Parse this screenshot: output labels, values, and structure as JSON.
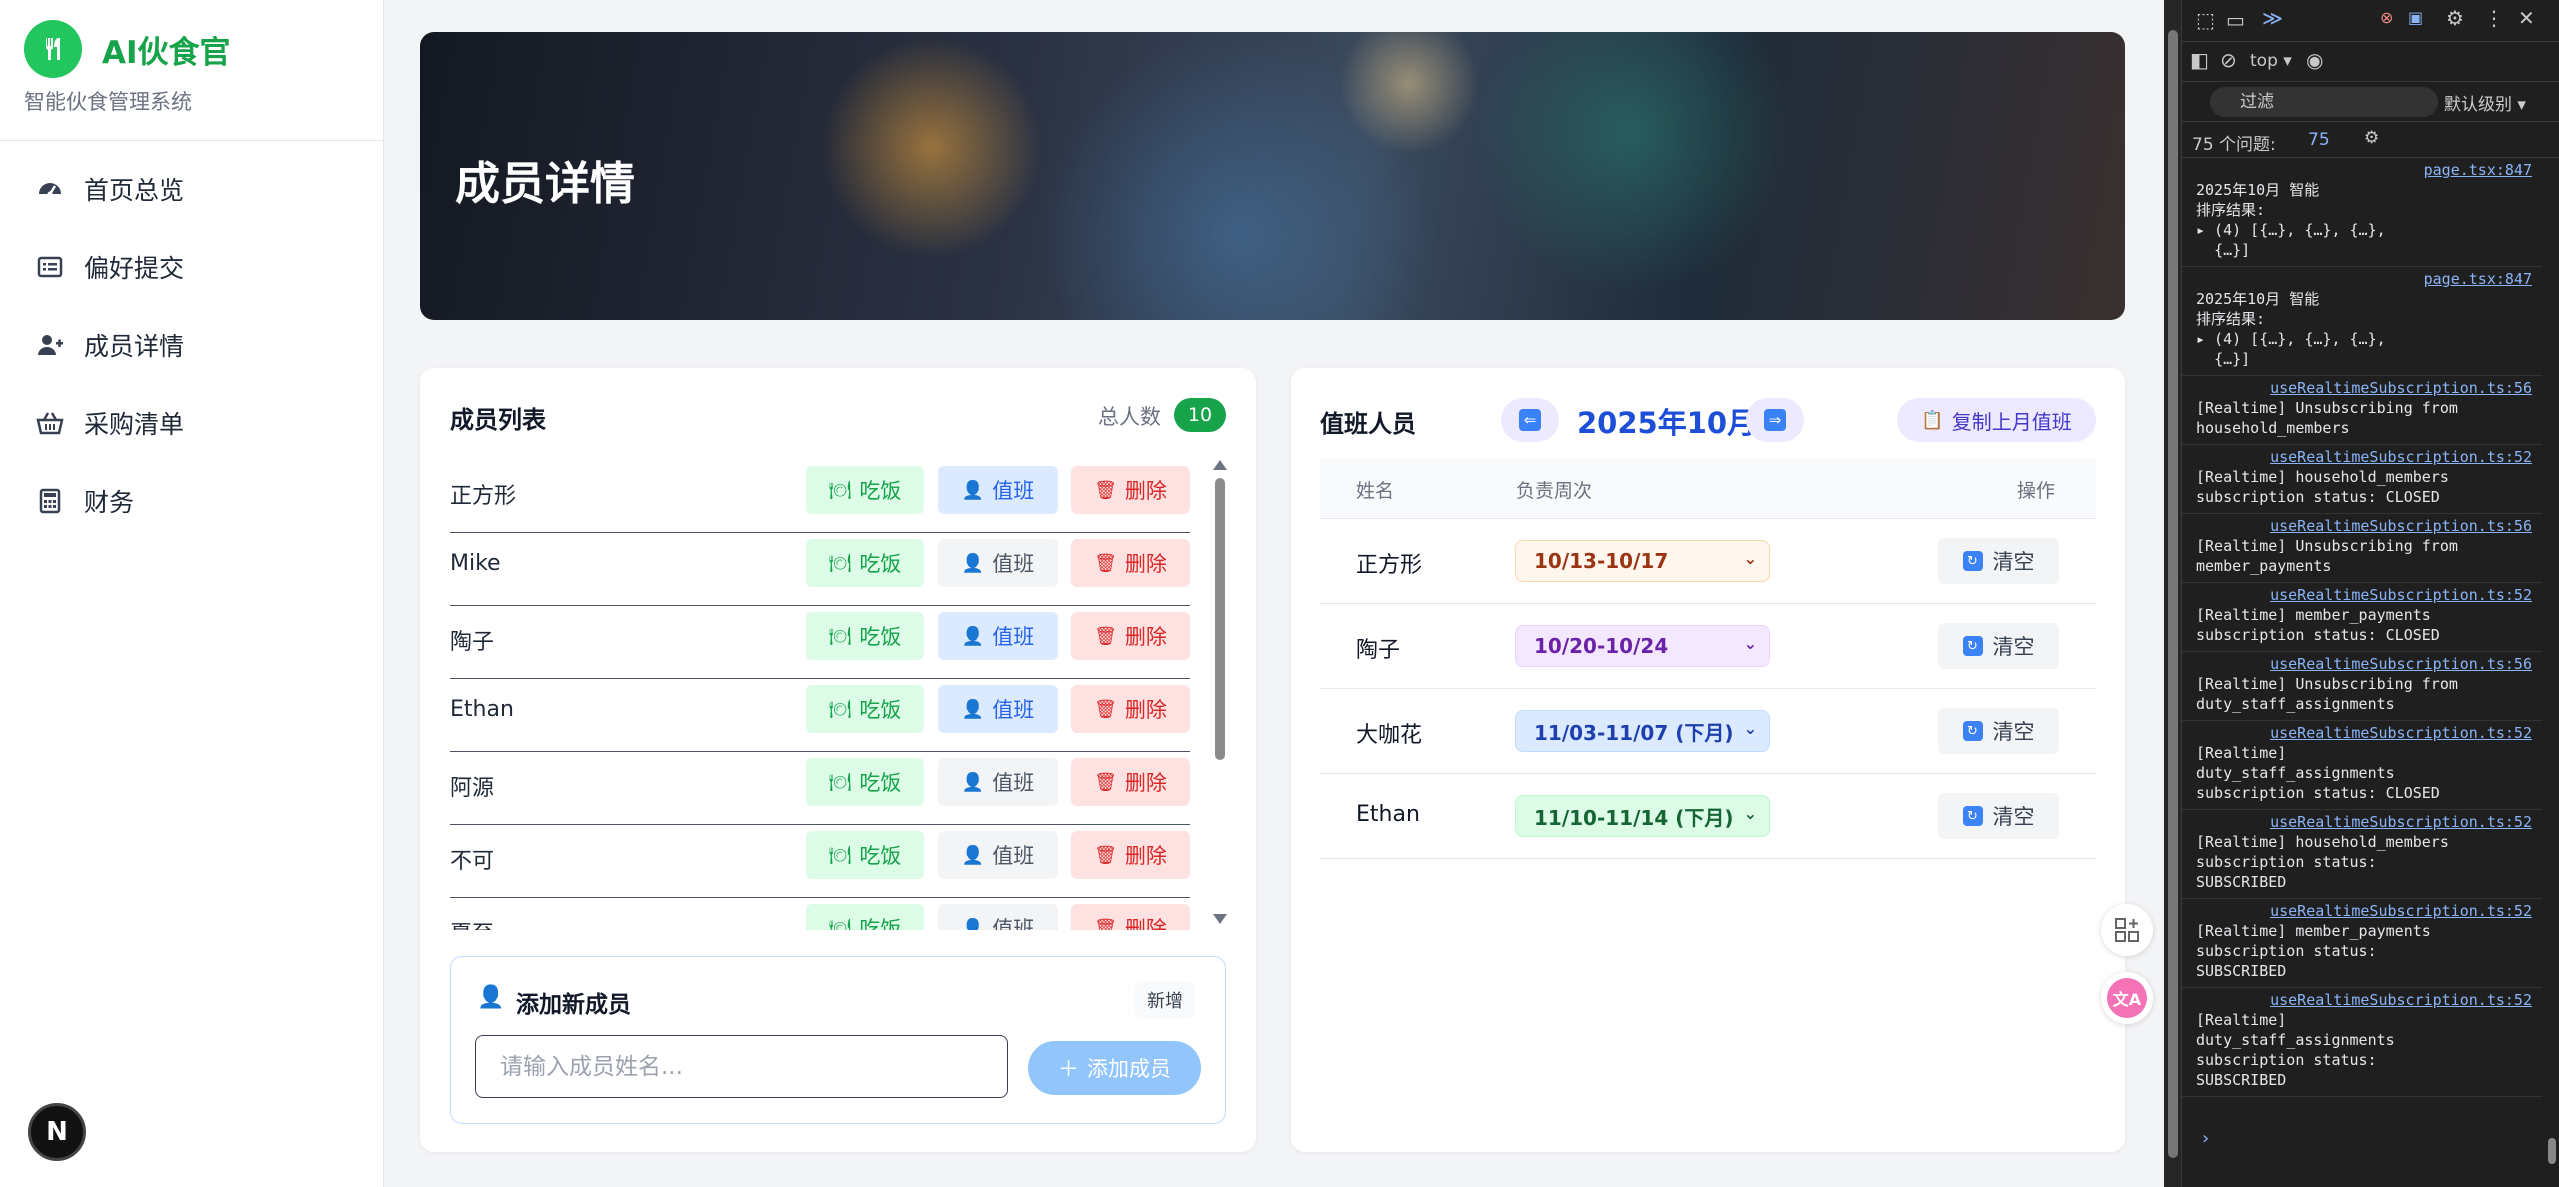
{
  "sidebar": {
    "brand_name": "AI伙食官",
    "brand_sub": "智能伙食管理系统",
    "items": [
      {
        "label": "首页总览"
      },
      {
        "label": "偏好提交"
      },
      {
        "label": "成员详情"
      },
      {
        "label": "采购清单"
      },
      {
        "label": "财务"
      }
    ],
    "next_badge": "N"
  },
  "hero": {
    "title": "成员详情"
  },
  "members": {
    "title": "成员列表",
    "total_label": "总人数",
    "total_count": "10",
    "eat_label": "吃饭",
    "duty_label": "值班",
    "delete_label": "删除",
    "rows": [
      {
        "name": "正方形",
        "on_duty": true
      },
      {
        "name": "Mike",
        "on_duty": false
      },
      {
        "name": "陶子",
        "on_duty": true
      },
      {
        "name": "Ethan",
        "on_duty": true
      },
      {
        "name": "阿源",
        "on_duty": false
      },
      {
        "name": "不可",
        "on_duty": false
      },
      {
        "name": "夏至",
        "on_duty": false
      }
    ],
    "add": {
      "title": "添加新成员",
      "tag": "新增",
      "placeholder": "请输入成员姓名...",
      "button": "添加成员"
    }
  },
  "duty": {
    "title": "值班人员",
    "month": "2025年10月",
    "copy_button": "复制上月值班",
    "headers": {
      "name": "姓名",
      "week": "负责周次",
      "action": "操作"
    },
    "clear_label": "清空",
    "rows": [
      {
        "name": "正方形",
        "week": "10/13-10/17",
        "bg": "#fff7ed",
        "fg": "#9a3412",
        "border": "#fed7aa"
      },
      {
        "name": "陶子",
        "week": "10/20-10/24",
        "bg": "#f3e8ff",
        "fg": "#6b21a8",
        "border": "#e9d5ff"
      },
      {
        "name": "大咖花",
        "week": "11/03-11/07 (下月)",
        "bg": "#dbeafe",
        "fg": "#1e40af",
        "border": "#bfdbfe"
      },
      {
        "name": "Ethan",
        "week": "11/10-11/14 (下月)",
        "bg": "#dcfce7",
        "fg": "#166534",
        "border": "#bbf7d0"
      }
    ]
  },
  "devtools": {
    "context": "top",
    "filter_placeholder": "过滤",
    "level": "默认级别",
    "issues": "75 个问题:",
    "issues_count": "75",
    "logs": [
      {
        "src": "page.tsx:847",
        "msg": "2025年10月 智能\n排序结果:\n▸ (4) [{…}, {…}, {…},\n  {…}]"
      },
      {
        "src": "page.tsx:847",
        "msg": "2025年10月 智能\n排序结果:\n▸ (4) [{…}, {…}, {…},\n  {…}]"
      },
      {
        "src": "useRealtimeSubscription.ts:56",
        "msg": "[Realtime] Unsubscribing from household_members"
      },
      {
        "src": "useRealtimeSubscription.ts:52",
        "msg": "[Realtime] household_members subscription status: CLOSED"
      },
      {
        "src": "useRealtimeSubscription.ts:56",
        "msg": "[Realtime] Unsubscribing from member_payments"
      },
      {
        "src": "useRealtimeSubscription.ts:52",
        "msg": "[Realtime] member_payments subscription status: CLOSED"
      },
      {
        "src": "useRealtimeSubscription.ts:56",
        "msg": "[Realtime] Unsubscribing from duty_staff_assignments"
      },
      {
        "src": "useRealtimeSubscription.ts:52",
        "msg": "[Realtime]\nduty_staff_assignments\nsubscription status: CLOSED"
      },
      {
        "src": "useRealtimeSubscription.ts:52",
        "msg": "[Realtime] household_members\nsubscription status:\nSUBSCRIBED"
      },
      {
        "src": "useRealtimeSubscription.ts:52",
        "msg": "[Realtime] member_payments\nsubscription status:\nSUBSCRIBED"
      },
      {
        "src": "useRealtimeSubscription.ts:52",
        "msg": "[Realtime]\nduty_staff_assignments\nsubscription status:\nSUBSCRIBED"
      }
    ]
  }
}
